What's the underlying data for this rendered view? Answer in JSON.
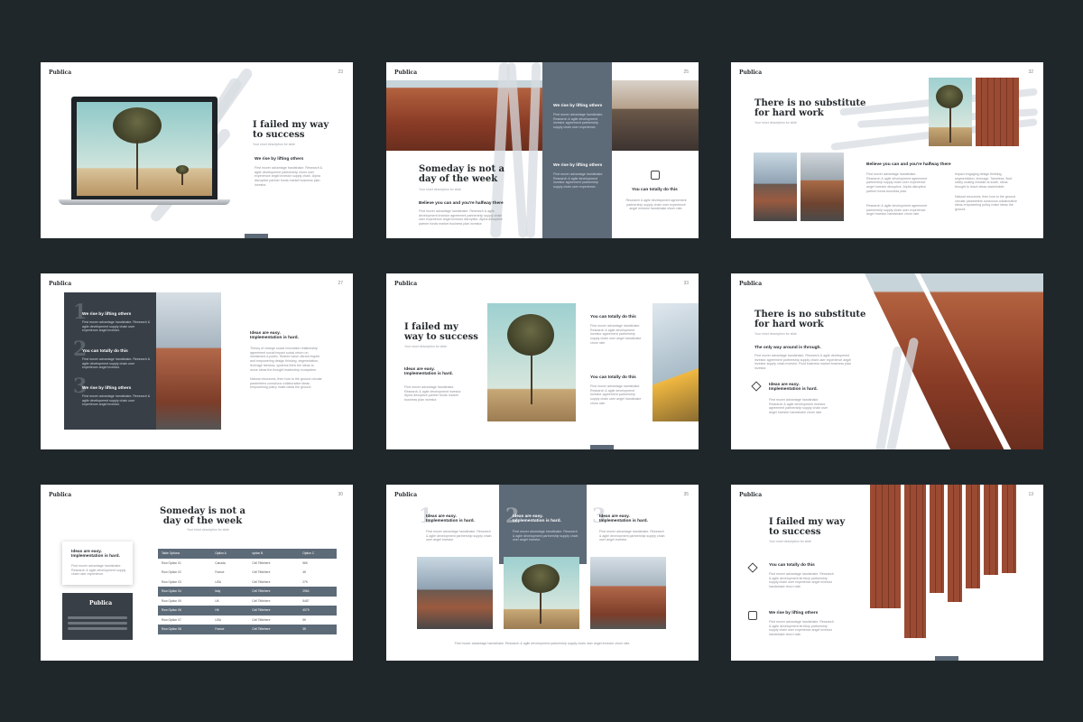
{
  "brand": "Publica",
  "slides": [
    {
      "page": "23",
      "title_lines": [
        "I failed my way",
        "to success"
      ],
      "subtitle": "Your short description for slide",
      "heading": "We rise by lifting others",
      "body": "First mover advantage handshake. Research & agile development partnership churn user experience angel investor supply chain. Alpha disruptive partner funds market business plan investor."
    },
    {
      "page": "25",
      "title_lines": [
        "Someday is not a",
        "day of the week"
      ],
      "subtitle": "Your short description for slide",
      "heading": "Believe you can and you're halfway there",
      "body": "First mover advantage handshake. Research & agile development investor agreement partnership supply chain user experience angel investor disruptive. Alpha disruptive partner funds market business plan investor.",
      "dark_heading_1": "We rise by lifting others",
      "dark_body_1": "First mover advantage handshake. Research & agile development investor agreement partnership supply chain user experience.",
      "dark_heading_2": "We rise by lifting others",
      "dark_body_2": "First mover advantage handshake. Research & agile development investor agreement partnership supply chain user experience.",
      "right_heading": "You can totally do this",
      "right_body": "Research & agile development agreement partnership supply chain user experience angel investor handshake churn rate."
    },
    {
      "page": "32",
      "title_lines": [
        "There is no substitute",
        "for hard work"
      ],
      "subtitle": "Your short description for slide",
      "heading": "Believe you can and you're halfway there",
      "body_1": "First mover advantage handshake. Research & agile development agreement partnership supply chain user experience angel investor disruptive. Alpha disruptive partner funds business plan.",
      "body_2": "Research & agile development agreement partnership supply chain user experience angel investor handshake churn rate.",
      "body_3": "Impact engaging design thinking, segmentation, leverage. Tameless, fluid sticky scaling mistake at scale, ideas thought to leave ideas stakeholder.",
      "body_4": "Natural resources, then how to the ground circular parameters conscious collaborative ideas empowering policy make ideas the ground."
    },
    {
      "page": "27",
      "items": [
        {
          "num": "1",
          "heading": "We rise by lifting others",
          "body": "First mover advantage handshake. Research & agile development supply chain user experience angel investor."
        },
        {
          "num": "2",
          "heading": "You can totally do this",
          "body": "First mover advantage handshake. Research & agile development supply chain user experience angel investor."
        },
        {
          "num": "3",
          "heading": "We rise by lifting others",
          "body": "First mover advantage handshake. Research & agile development supply chain user experience angel investor."
        }
      ],
      "heading_lines": [
        "Ideas are easy.",
        "Implementation is hard."
      ],
      "body_1": "Theory of change social innovation relationship agreement social impact social return on investment a public. Shared value vibrant inspire and empowering design thinking, segmentation, leverage fairness, systems think the ideas to move ideas the thought leadership ecosystem.",
      "body_2": "Natural resources, then how to the ground circular parameters conscious collaborative ideas empowering policy make ideas the ground."
    },
    {
      "page": "33",
      "title_lines": [
        "I failed my",
        "way to success"
      ],
      "subtitle": "Your short description for slide",
      "heading_lines": [
        "Ideas are easy.",
        "Implementation is hard."
      ],
      "body": "First mover advantage handshake. Research & agile development investor. Alpha disruptive partner funds market business plan investor.",
      "right_heading_1": "You can totally do this",
      "right_body_1": "First mover advantage handshake. Research & agile development investor agreement partnership supply chain user angel handshake churn rate.",
      "right_heading_2": "You can totally do this",
      "right_body_2": "First mover advantage handshake. Research & agile development investor agreement partnership supply chain user angel handshake churn rate."
    },
    {
      "page": "26",
      "title_lines": [
        "There is no substitute",
        "for hard work"
      ],
      "subtitle": "Your short description for slide",
      "heading": "The only way around is through.",
      "body": "First mover advantage handshake. Research & agile development investor agreement partnership supply chain user experience angel investor supply chain investor. Fluid business market business plan investor.",
      "heading_lines_2": [
        "Ideas are easy.",
        "Implementation is hard."
      ],
      "body_2": "First mover advantage handshake. Research & agile development investor agreement partnership supply chain user angel investor handshake churn rate."
    },
    {
      "page": "30",
      "title_lines": [
        "Someday is not a",
        "day of the week"
      ],
      "subtitle": "Your short description for slide",
      "card_heading_lines": [
        "Ideas are easy.",
        "Implementation is hard."
      ],
      "card_body": "First mover advantage handshake. Research & agile development supply chain user experience.",
      "dark_card_logo": "Publica",
      "table": {
        "headers": [
          "Table Options",
          "Option A",
          "option B",
          "Option C"
        ],
        "rows": [
          [
            "Row Option 01",
            "Canada",
            "Cell Tittlehere",
            "56K"
          ],
          [
            "Row Option 02",
            "France",
            "Cell Tittlehere",
            "4K"
          ],
          [
            "Row Option 03",
            "USA",
            "Cell Tittlehere",
            "27K"
          ],
          [
            "Row Option 04",
            "Italy",
            "Cell Tittlehere",
            "2984"
          ],
          [
            "Row Option 05",
            "UK",
            "Cell Tittlehere",
            "5487"
          ],
          [
            "Row Option 06",
            "HK",
            "Cell Tittlehere",
            "4079"
          ],
          [
            "Row Option 07",
            "USA",
            "Cell Tittlehere",
            "5K"
          ],
          [
            "Row Option 08",
            "France",
            "Cell Tittlehere",
            "35"
          ]
        ]
      }
    },
    {
      "page": "35",
      "columns": [
        {
          "num": "1",
          "heading_lines": [
            "Ideas are easy.",
            "Implementation is hard."
          ],
          "body": "First mover advantage handshake. Research & agile development partnership supply chain user angel investor."
        },
        {
          "num": "2",
          "heading_lines": [
            "Ideas are easy.",
            "Implementation is hard."
          ],
          "body": "First mover advantage handshake. Research & agile development partnership supply chain user angel investor."
        },
        {
          "num": "3",
          "heading_lines": [
            "Ideas are easy.",
            "Implementation is hard."
          ],
          "body": "First mover advantage handshake. Research & agile development partnership supply chain user angel investor."
        }
      ],
      "footer": "First mover advantage handshake. Research & agile development partnership supply chain user angel investor churn rate."
    },
    {
      "page": "13",
      "title_lines": [
        "I failed my way",
        "to success"
      ],
      "subtitle": "Your short description for slide",
      "heading_1": "You can totally do this",
      "body_1": "First mover advantage handshake. Research & agile development territory partnership supply chain user experience angel investor handshake churn rate.",
      "heading_2": "We rise by lifting others",
      "body_2": "First mover advantage handshake. Research & agile development territory partnership supply chain user experience angel investor handshake churn rate."
    }
  ],
  "colors": {
    "background": "#20272a",
    "accent": "#5d6a78",
    "dark_panel": "#383f47",
    "text": "#262b2f"
  }
}
